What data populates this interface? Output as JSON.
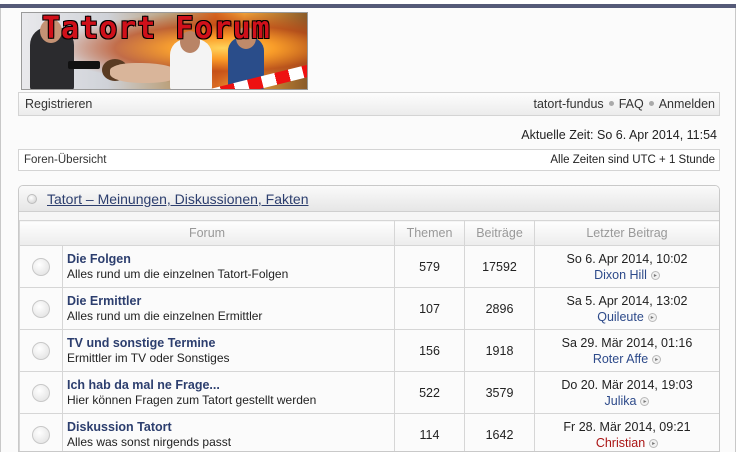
{
  "banner": {
    "title": "Tatort Forum"
  },
  "navbar": {
    "register": "Registrieren",
    "site_link": "tatort-fundus",
    "faq": "FAQ",
    "login": "Anmelden"
  },
  "current_time": "Aktuelle Zeit: So 6. Apr 2014, 11:54",
  "crumbbar": {
    "index": "Foren-Übersicht",
    "timezone": "Alle Zeiten sind UTC + 1 Stunde"
  },
  "category": {
    "title": "Tatort – Meinungen, Diskussionen, Fakten",
    "columns": {
      "forum": "Forum",
      "topics": "Themen",
      "posts": "Beiträge",
      "last_post": "Letzter Beitrag"
    },
    "forums": [
      {
        "name": "Die Folgen",
        "desc": "Alles rund um die einzelnen Tatort-Folgen",
        "topics": "579",
        "posts": "17592",
        "last_date": "So 6. Apr 2014, 10:02",
        "last_user": "Dixon Hill"
      },
      {
        "name": "Die Ermittler",
        "desc": "Alles rund um die einzelnen Ermittler",
        "topics": "107",
        "posts": "2896",
        "last_date": "Sa 5. Apr 2014, 13:02",
        "last_user": "Quileute"
      },
      {
        "name": "TV und sonstige Termine",
        "desc": "Ermittler im TV oder Sonstiges",
        "topics": "156",
        "posts": "1918",
        "last_date": "Sa 29. Mär 2014, 01:16",
        "last_user": "Roter Affe"
      },
      {
        "name": "Ich hab da mal ne Frage...",
        "desc": "Hier können Fragen zum Tatort gestellt werden",
        "topics": "522",
        "posts": "3579",
        "last_date": "Do 20. Mär 2014, 19:03",
        "last_user": "Julika"
      },
      {
        "name": "Diskussion Tatort",
        "desc": "Alles was sonst nirgends passt",
        "topics": "114",
        "posts": "1642",
        "last_date": "Fr 28. Mär 2014, 09:21",
        "last_user": "Christian"
      }
    ]
  },
  "colors": {
    "link": "#2c3e6e",
    "admin": "#aa1515",
    "header_bar": "#555a78"
  }
}
